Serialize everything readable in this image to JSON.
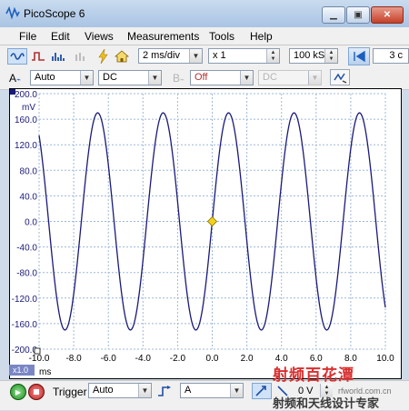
{
  "window": {
    "title": "PicoScope 6"
  },
  "menu": [
    "File",
    "Edit",
    "Views",
    "Measurements",
    "Tools",
    "Help"
  ],
  "toolbar1": {
    "timebase": "2 ms/div",
    "zoom": "x 1",
    "samples": "100 kS",
    "capture_count": "3 c"
  },
  "toolbar2": {
    "channel_a_label": "A",
    "channel_a_range": "Auto",
    "channel_a_coupling": "DC",
    "channel_b_label": "B",
    "channel_b_range": "Off",
    "channel_b_coupling": "DC"
  },
  "statusbar": {
    "trigger_label": "Trigger",
    "trigger_mode": "Auto",
    "trigger_source": "A",
    "trigger_level": "0 V"
  },
  "watermark": {
    "brand": "射频百花潭",
    "site": "rfworld.com.cn",
    "slogan": "射频和天线设计专家"
  },
  "chart_data": {
    "type": "line",
    "series": [
      {
        "amplitude_mv": 170,
        "period_ms": 3.78,
        "phase_note": "crosses 0 mV at 0 ms rising"
      }
    ],
    "x": {
      "ticks": [
        "-10.0",
        "-8.0",
        "-6.0",
        "-4.0",
        "-2.0",
        "0.0",
        "2.0",
        "4.0",
        "6.0",
        "8.0",
        "10.0"
      ],
      "unit": "ms",
      "range": [
        -10,
        10
      ],
      "scale_tag": "x1.0"
    },
    "y": {
      "ticks": [
        "200.0",
        "160.0",
        "120.0",
        "80.0",
        "40.0",
        "0.0",
        "-40.0",
        "-80.0",
        "-120.0",
        "-160.0",
        "-200.0"
      ],
      "unit": "mV",
      "range": [
        -200,
        200
      ]
    },
    "trigger_marker": {
      "x": 0,
      "y": 0
    },
    "grid": true,
    "colors": {
      "trace": "#1a1a7a",
      "grid": "#9cb8d8",
      "trigger": "#f2d21b"
    }
  }
}
